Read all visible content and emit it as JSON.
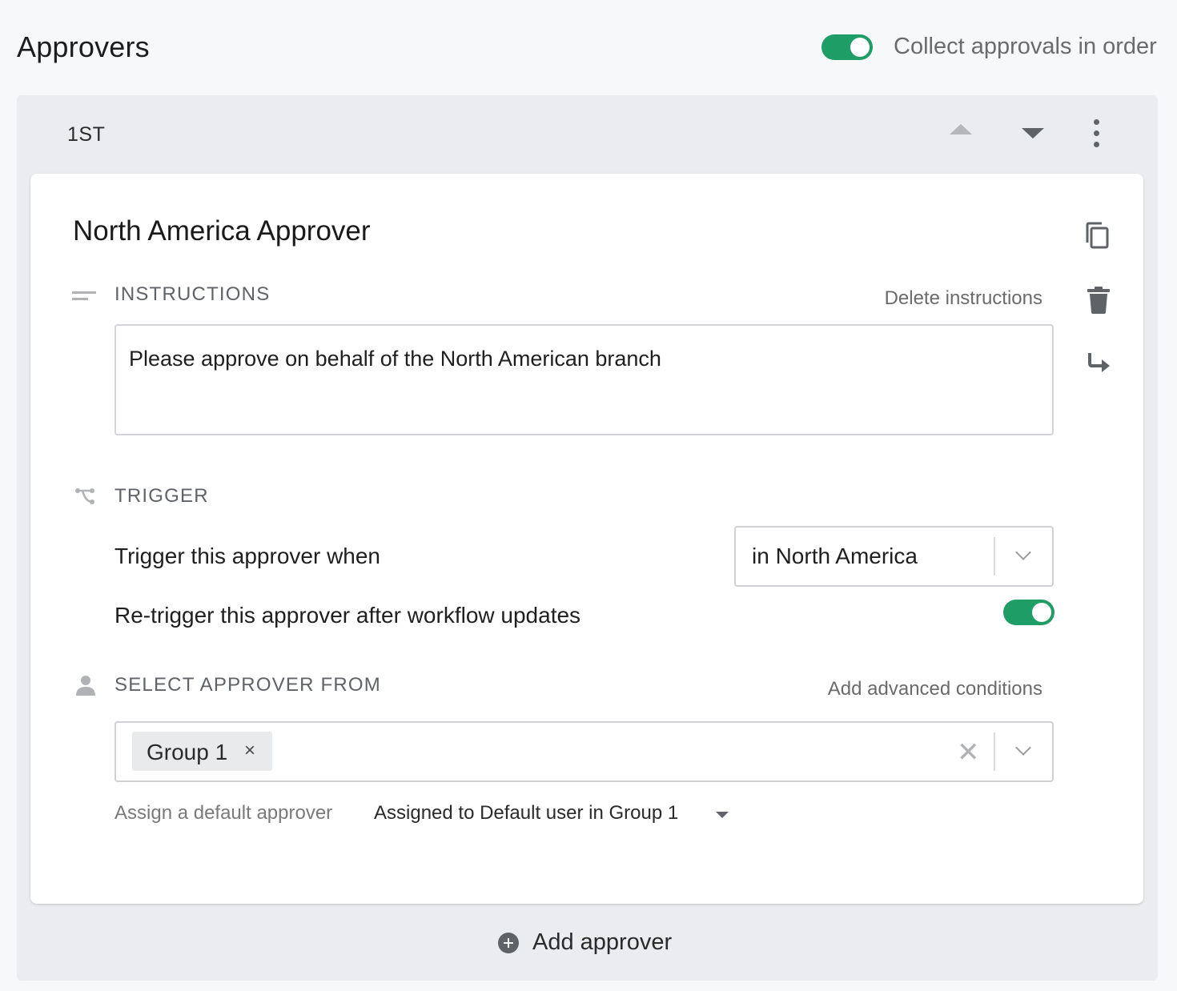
{
  "header": {
    "title": "Approvers",
    "order_toggle_on": true,
    "order_label": "Collect approvals in order"
  },
  "stage": {
    "label": "1ST",
    "move_up_icon": "caret-up-icon",
    "move_down_icon": "caret-down-icon",
    "menu_icon": "more-vertical-icon"
  },
  "approver": {
    "name": "North America Approver",
    "side_actions": [
      "copy-icon",
      "trash-icon",
      "redirect-icon"
    ],
    "instructions": {
      "label": "INSTRUCTIONS",
      "action": "Delete instructions",
      "value": "Please approve on behalf of the North American branch"
    },
    "trigger": {
      "label": "TRIGGER",
      "condition_label": "Trigger this approver when",
      "condition_value": "in North America",
      "retrigger_label": "Re-trigger this approver after workflow updates",
      "retrigger_on": true
    },
    "select_from": {
      "label": "SELECT APPROVER FROM",
      "action": "Add advanced conditions",
      "chips": [
        "Group 1"
      ],
      "chip_remove_glyph": "×",
      "clear_glyph": "✕"
    },
    "default": {
      "label": "Assign a default approver",
      "value": "Assigned to Default user in Group 1"
    }
  },
  "add_approver_label": "Add approver",
  "colors": {
    "toggle_on": "#1f9d66",
    "stage_bg": "#ebecef",
    "card_bg": "#ffffff",
    "muted_text": "#5f6368"
  }
}
